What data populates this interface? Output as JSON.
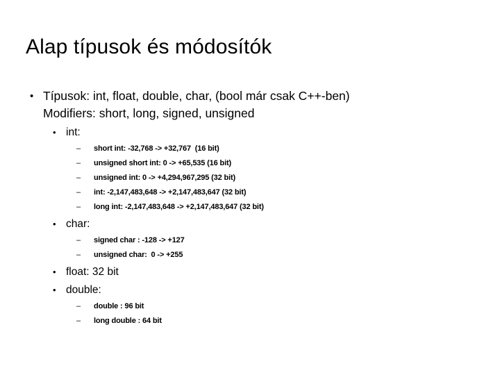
{
  "slide": {
    "title": "Alap típusok és módosítók",
    "background_color": "#ffffff",
    "text_color": "#000000",
    "markers": {
      "level1": "•",
      "level2": "•",
      "level3": "–"
    },
    "body": {
      "intro": {
        "line1": "Típusok: int, float, double, char, (bool már csak C++-ben)",
        "line2": "Modifiers: short, long, signed, unsigned"
      },
      "groups": [
        {
          "heading": "int:",
          "items": [
            "short int: -32,768 -> +32,767  (16 bit)",
            "unsigned short int: 0 -> +65,535 (16 bit)",
            "unsigned int: 0 -> +4,294,967,295 (32 bit)",
            "int: -2,147,483,648 -> +2,147,483,647 (32 bit)",
            "long int: -2,147,483,648 -> +2,147,483,647 (32 bit)"
          ]
        },
        {
          "heading": "char:",
          "items": [
            "signed char : -128 -> +127",
            "unsigned char:  0 -> +255"
          ]
        },
        {
          "heading": "float: 32 bit",
          "items": []
        },
        {
          "heading": "double:",
          "items": [
            "double : 96 bit",
            "long double : 64 bit"
          ]
        }
      ]
    }
  }
}
